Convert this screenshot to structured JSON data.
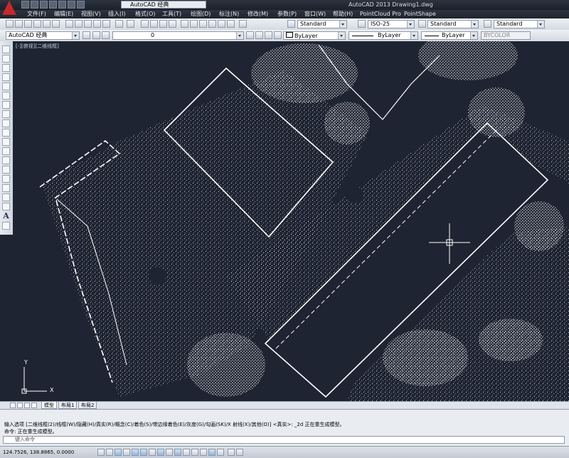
{
  "titlebar": {
    "workspace": "AutoCAD 经典",
    "title": "AutoCAD 2013    Drawing1.dwg"
  },
  "menu": [
    "文件(F)",
    "编辑(E)",
    "视图(V)",
    "插入(I)",
    "格式(O)",
    "工具(T)",
    "绘图(D)",
    "标注(N)",
    "修改(M)",
    "参数(P)",
    "窗口(W)",
    "帮助(H)",
    "PointCloud Pro",
    "PointShape"
  ],
  "toolbar1": {
    "text_style": "Standard",
    "dim_style": "ISO-25",
    "table_style": "Standard",
    "mleader_style": "Standard"
  },
  "toolbar2": {
    "workspace": "AutoCAD 经典",
    "layer": "0",
    "color": "ByLayer",
    "linetype": "ByLayer",
    "lineweight": "ByLayer",
    "plotstyle": "BYCOLOR"
  },
  "canvas": {
    "viewport_label": "[-][俯视][二维线框]",
    "ucs_x": "X",
    "ucs_y": "Y",
    "background": "#1e2432"
  },
  "tabs": [
    "模型",
    "布局1",
    "布局2"
  ],
  "command": {
    "line1": "输入选项 [二维线框(2)/线框(W)/隐藏(H)/真实(R)/概念(C)/着色(S)/带边缘着色(E)/灰度(G)/勾画(SK)/X 射线(X)/其他(O)] <真实>: _2d 正在重生成模型。",
    "line2": "命令:  正在重生成模型。",
    "placeholder": "键入命令"
  },
  "status": {
    "coords": "124.7526, 138.8865, 0.0000"
  }
}
